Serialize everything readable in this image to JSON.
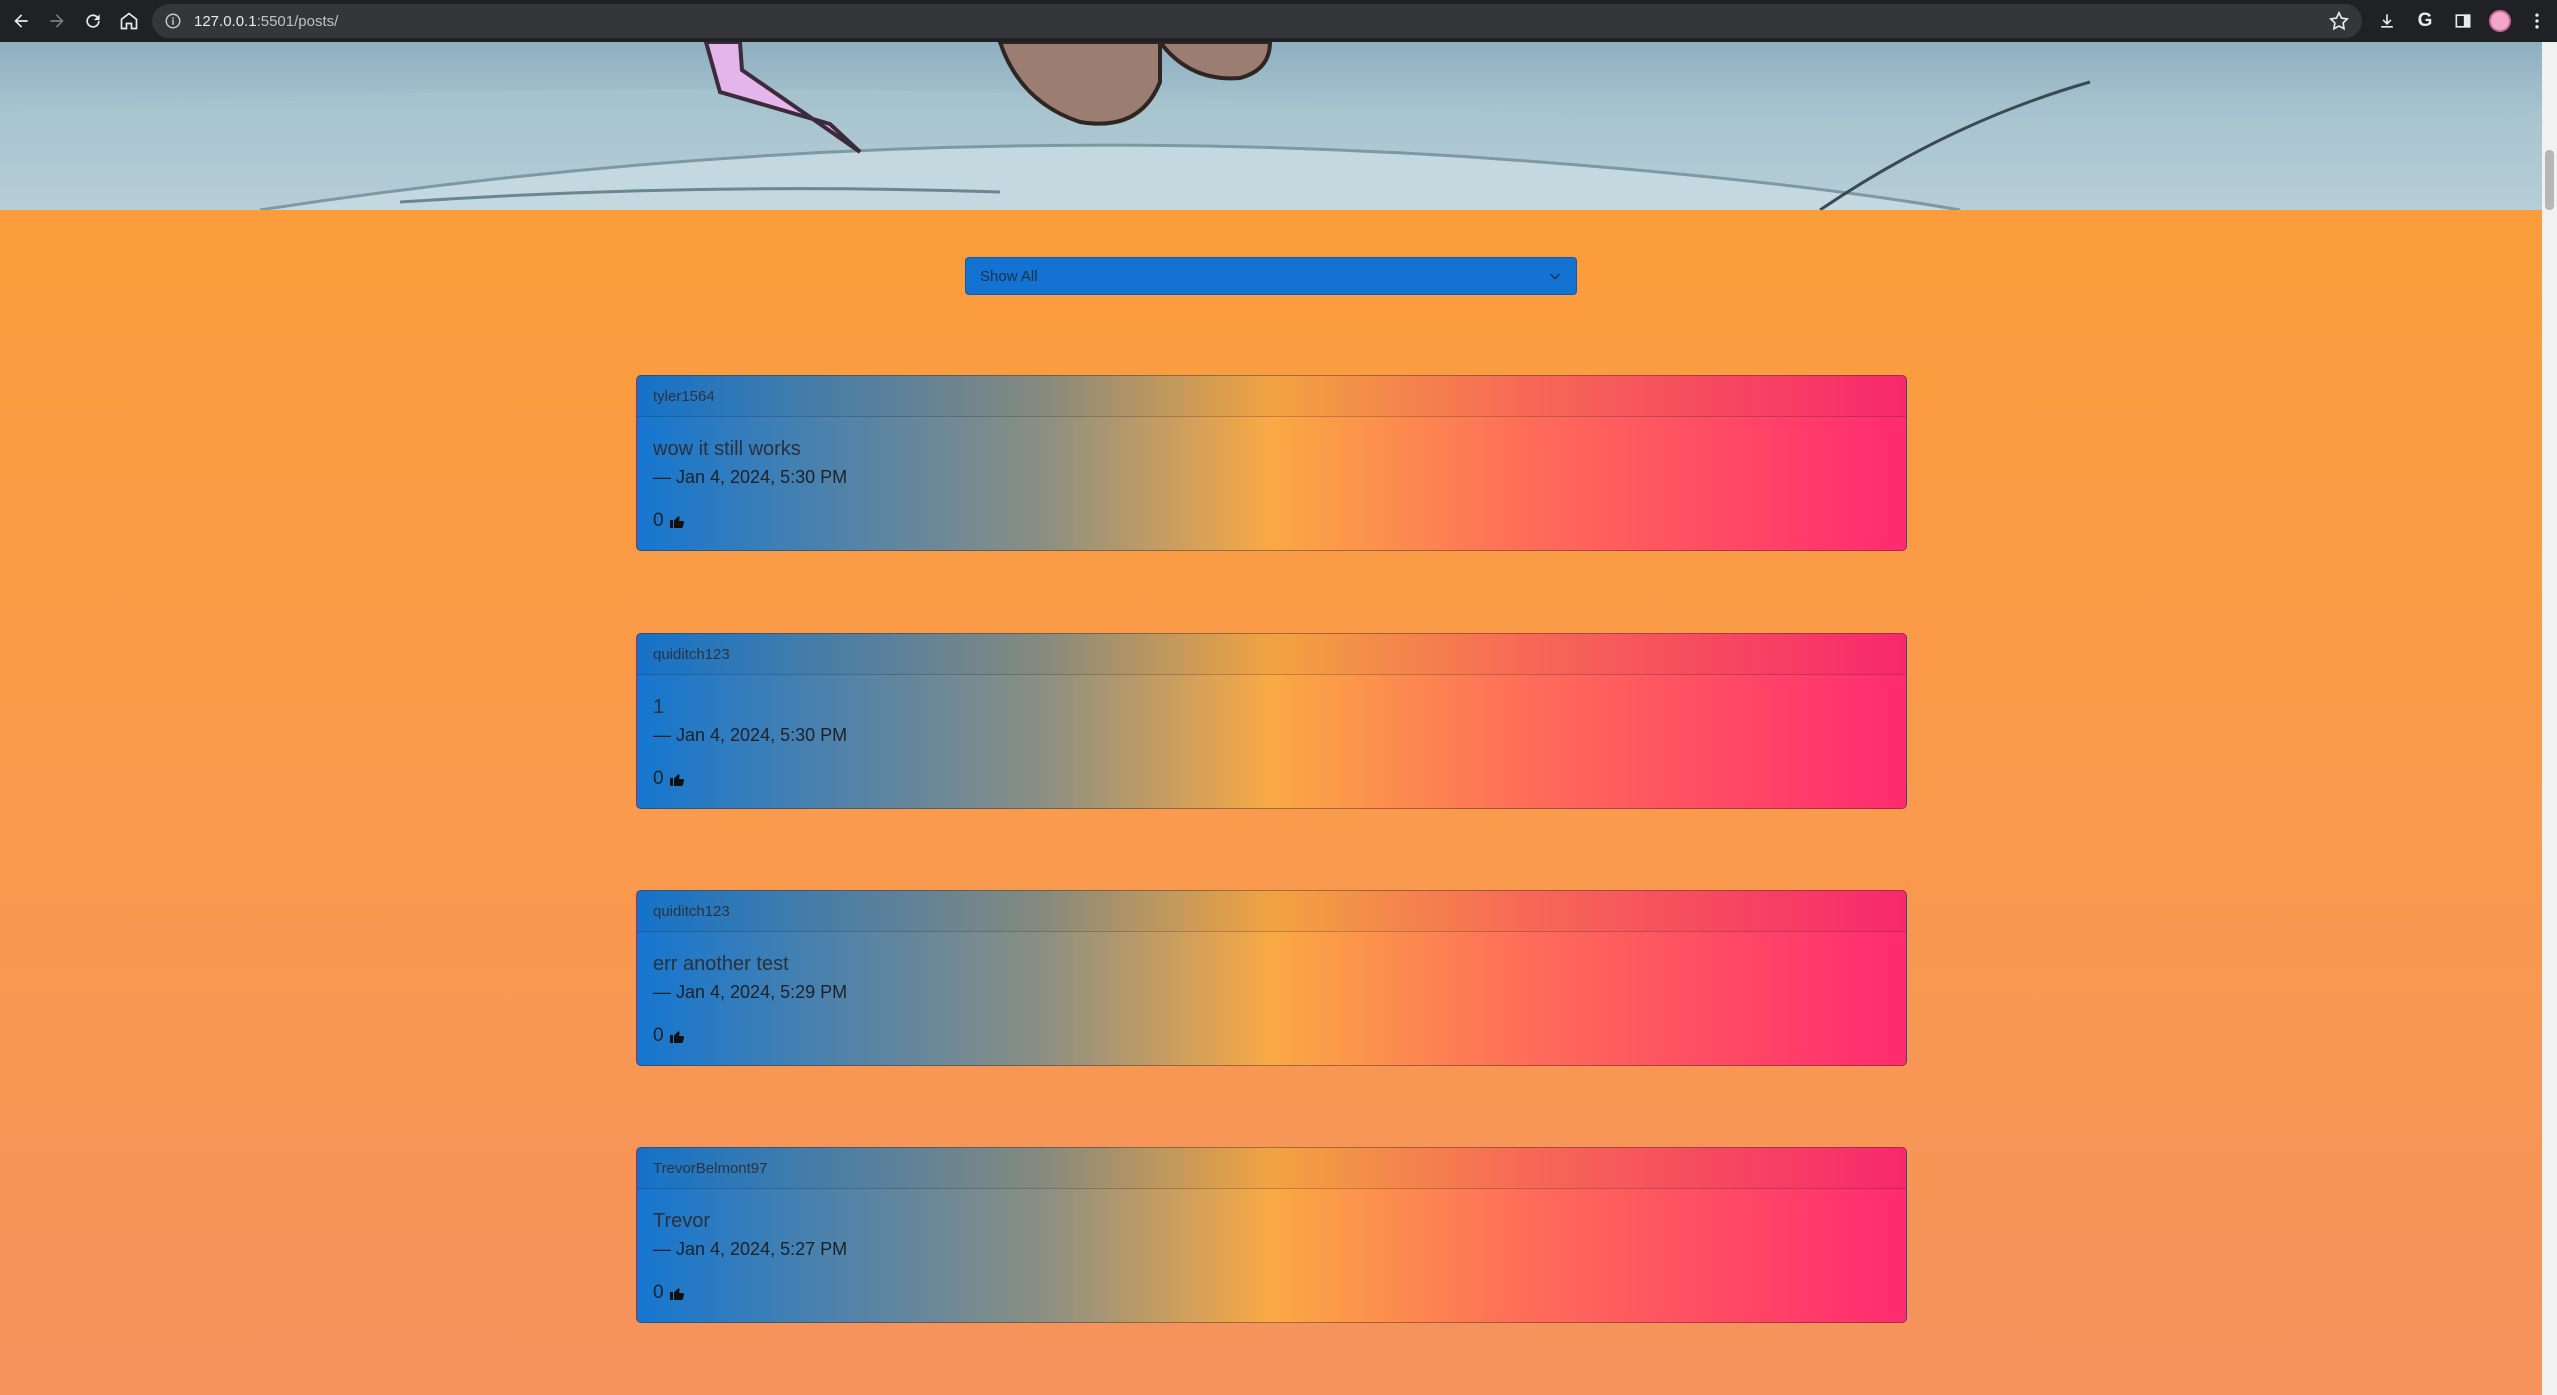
{
  "browser": {
    "url_host": "127.0.0.1",
    "url_rest": ":5501/posts/",
    "icons": [
      "back-icon",
      "forward-icon",
      "reload-icon",
      "home-icon",
      "site-info-icon",
      "bookmark-star-icon",
      "download-icon",
      "google-icon",
      "side-panel-icon",
      "profile-avatar",
      "menu-icon"
    ]
  },
  "filter": {
    "selected": "Show All"
  },
  "posts": [
    {
      "author": "tyler1564",
      "text": "wow it still works",
      "meta": "— Jan 4, 2024, 5:30 PM",
      "likes": "0"
    },
    {
      "author": "quiditch123",
      "text": "1",
      "meta": "— Jan 4, 2024, 5:30 PM",
      "likes": "0"
    },
    {
      "author": "quiditch123",
      "text": "err another test",
      "meta": "— Jan 4, 2024, 5:29 PM",
      "likes": "0"
    },
    {
      "author": "TrevorBelmont97",
      "text": "Trevor",
      "meta": "— Jan 4, 2024, 5:27 PM",
      "likes": "0"
    }
  ],
  "colors": {
    "page_orange": "#fb9c3b",
    "select_blue": "#1473d2",
    "card_gradient": [
      "#1576d0",
      "#faa944",
      "#ff2a70"
    ]
  }
}
